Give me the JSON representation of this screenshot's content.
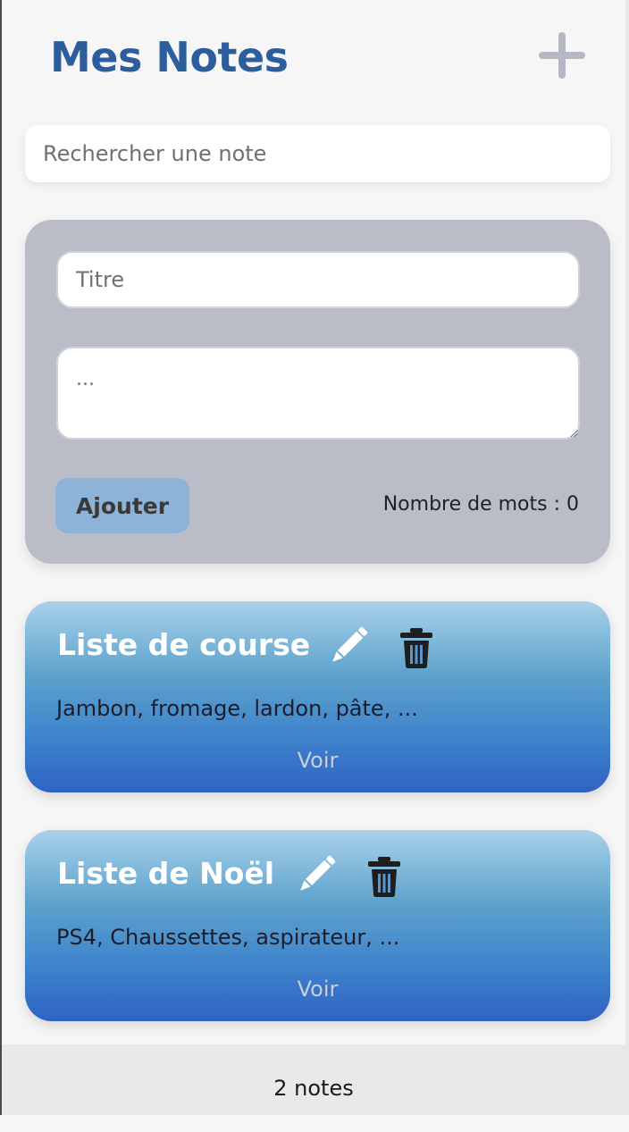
{
  "header": {
    "title": "Mes Notes",
    "add_icon": "plus-icon"
  },
  "search": {
    "placeholder": "Rechercher une note",
    "value": ""
  },
  "form": {
    "title_placeholder": "Titre",
    "title_value": "",
    "body_placeholder": "...",
    "body_value": "",
    "submit_label": "Ajouter",
    "word_count": "Nombre de mots : 0"
  },
  "notes": [
    {
      "title": "Liste de course",
      "excerpt": "Jambon, fromage, lardon, pâte, ...",
      "view_label": "Voir",
      "edit_icon": "pencil-icon",
      "delete_icon": "trash-icon"
    },
    {
      "title": "Liste de Noël",
      "excerpt": "PS4, Chaussettes, aspirateur, ...",
      "view_label": "Voir",
      "edit_icon": "pencil-icon",
      "delete_icon": "trash-icon"
    }
  ],
  "footer": {
    "count_text": "2 notes"
  },
  "colors": {
    "title": "#2c5e9e",
    "panel": "#babcc8",
    "button": "#8eb3d9",
    "card_top": "#a9d1ea",
    "card_bottom": "#2f63c4"
  }
}
